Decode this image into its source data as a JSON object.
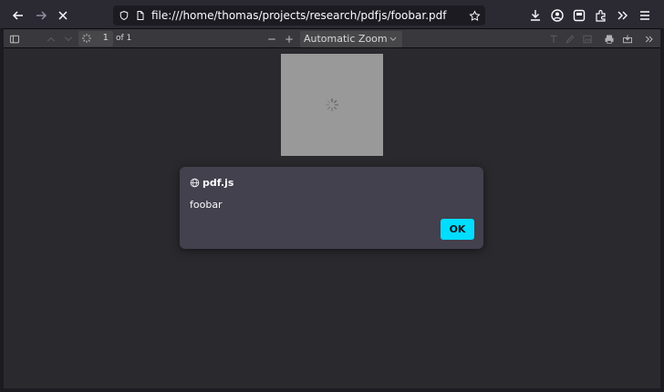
{
  "browser": {
    "url": "file:///home/thomas/projects/research/pdfjs/foobar.pdf"
  },
  "pdf_toolbar": {
    "page_number": "1",
    "page_count_label": "of 1",
    "zoom_label": "Automatic Zoom"
  },
  "dialog": {
    "title": "pdf.js",
    "message": "foobar",
    "ok_label": "OK"
  },
  "colors": {
    "accent": "#00ddff",
    "dialog_bg": "#42414d",
    "toolbar_bg": "#38383d",
    "viewer_bg": "#2a2a2e"
  }
}
